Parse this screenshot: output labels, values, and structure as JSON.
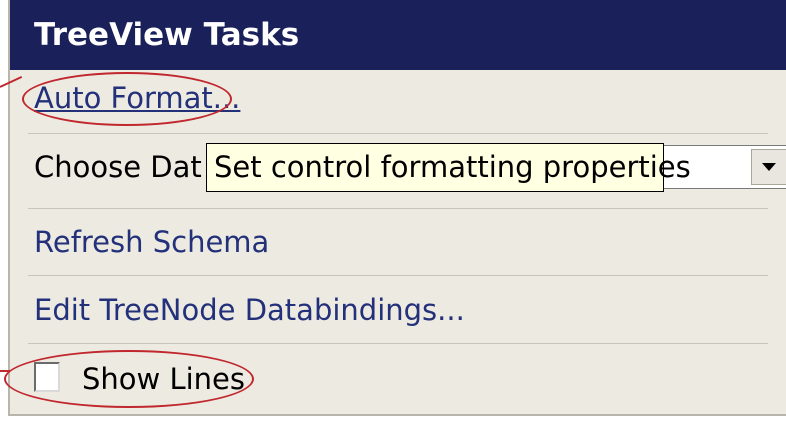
{
  "panel": {
    "title": "TreeView Tasks",
    "auto_format_label": "Auto Format...",
    "choose_data_source_label": "Choose Dat",
    "tooltip_text": "Set control formatting properties",
    "refresh_schema_label": "Refresh Schema",
    "edit_databindings_label": "Edit TreeNode Databindings...",
    "show_lines_label": "Show Lines",
    "show_lines_checked": false
  },
  "colors": {
    "title_bar": "#19205a",
    "panel_bg": "#edeae2",
    "link": "#23307a",
    "tooltip_bg": "#ffffe1",
    "annotation": "#c0282e"
  },
  "icons": {
    "dropdown_arrow": "chevron-down-icon"
  }
}
